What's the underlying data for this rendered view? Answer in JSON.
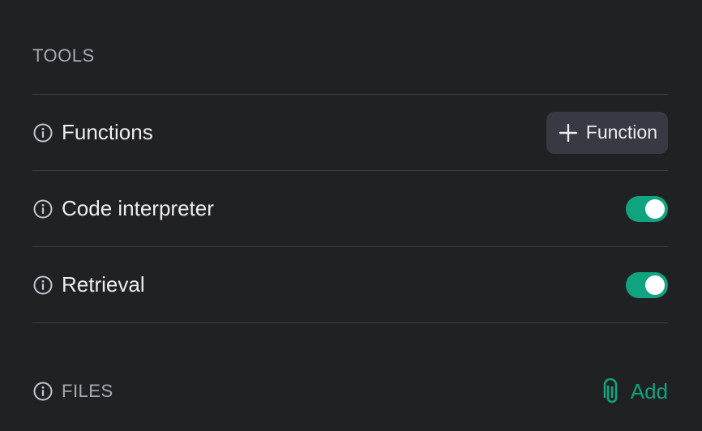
{
  "tools": {
    "title": "TOOLS",
    "functions": {
      "label": "Functions",
      "button_label": "Function"
    },
    "code_interpreter": {
      "label": "Code interpreter",
      "enabled": true
    },
    "retrieval": {
      "label": "Retrieval",
      "enabled": true
    }
  },
  "files": {
    "label": "FILES",
    "add_label": "Add"
  },
  "icons": {
    "info": "info-icon",
    "plus": "plus-icon",
    "attach": "paperclip-icon"
  },
  "colors": {
    "background": "#202123",
    "accent": "#10a37f",
    "button_bg": "#383942",
    "divider": "#3b3c42",
    "muted_text": "#a8a8b3",
    "text": "#ececf1"
  }
}
